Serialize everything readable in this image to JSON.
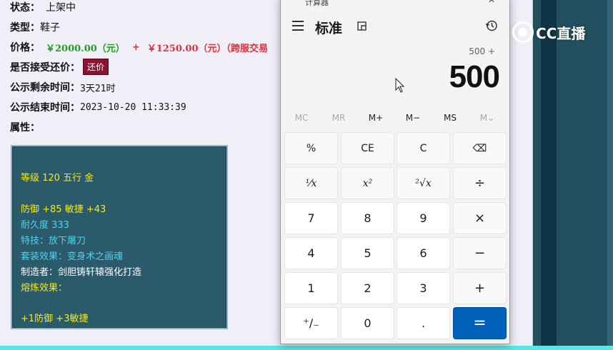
{
  "item": {
    "status_label": "状态：",
    "status_value": "上架中",
    "type_label": "类型：",
    "type_value": "鞋子",
    "price_label": "价格：",
    "price_main": "￥2000.00（元）",
    "price_plus": "+",
    "price_cross": "￥1250.00（元）（跨服交易",
    "counter_label": "是否接受还价：",
    "counter_button": "还价",
    "remain_label": "公示剩余时间：",
    "remain_value": "3天21时",
    "end_label": "公示结束时间：",
    "end_value": "2023-10-20 11:33:39",
    "attr_label": "属性："
  },
  "attributes": {
    "level": "等级 120 五行 金",
    "defense": "防御 +85 敏捷 +43",
    "durability": "耐久度 333",
    "skill": "特技：放下屠刀",
    "set_effect": "套装效果：变身术之画魂",
    "maker": "制造者：剑胆铸轩辕强化打造",
    "refine_label": "熔炼效果：",
    "refine_value": "+1防御 +3敏捷"
  },
  "stream": {
    "logo_text": "CC直播"
  },
  "calculator": {
    "title_partial": "计算器",
    "close_glyph": "✕",
    "mode": "标准",
    "expression": "500 +",
    "display": "500",
    "memory": [
      "MC",
      "MR",
      "M+",
      "M−",
      "MS",
      "M⌄"
    ],
    "keys": {
      "percent": "%",
      "ce": "CE",
      "clear": "C",
      "backspace": "⌫",
      "reciprocal": "⅟x",
      "square": "x²",
      "sqrt": "²√x",
      "divide": "÷",
      "seven": "7",
      "eight": "8",
      "nine": "9",
      "multiply": "×",
      "four": "4",
      "five": "5",
      "six": "6",
      "minus": "−",
      "one": "1",
      "two": "2",
      "three": "3",
      "plus": "+",
      "negate": "⁺∕₋",
      "zero": "0",
      "decimal": ".",
      "equals": "="
    },
    "colors": {
      "equals_bg": "#005fb8",
      "window_bg": "#f3f3f3"
    }
  }
}
